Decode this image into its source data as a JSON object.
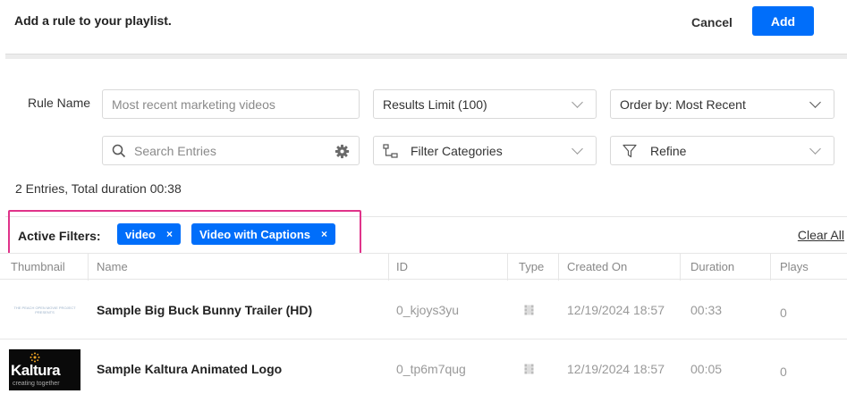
{
  "header": {
    "title": "Add a rule to your playlist.",
    "cancel_label": "Cancel",
    "add_label": "Add",
    "accent_color": "#006efa"
  },
  "form": {
    "rule_name_label": "Rule Name",
    "rule_name_placeholder": "Most recent marketing videos",
    "results_limit": "Results Limit (100)",
    "order_by": "Order by: Most Recent",
    "search_placeholder": "Search Entries",
    "filter_categories": "Filter Categories",
    "refine": "Refine"
  },
  "summary": "2 Entries, Total duration 00:38",
  "active_filters": {
    "label": "Active Filters:",
    "chips": [
      "video",
      "Video with Captions"
    ],
    "chip_close": "×",
    "clear_all": "Clear All",
    "highlight_color": "#e0338a"
  },
  "table": {
    "columns": [
      "Thumbnail",
      "Name",
      "ID",
      "Type",
      "Created On",
      "Duration",
      "Plays"
    ],
    "rows": [
      {
        "thumbnail_caption": "THE PEACH OPEN MOVIE PROJECT PRESENTS",
        "name": "Sample Big Buck Bunny Trailer (HD)",
        "id": "0_kjoys3yu",
        "type_icon": "film-icon",
        "created_on": "12/19/2024 18:57",
        "duration": "00:33",
        "plays": "0"
      },
      {
        "thumbnail_logo": "Kaltura",
        "thumbnail_tagline": "creating together",
        "name": "Sample Kaltura Animated Logo",
        "id": "0_tp6m7qug",
        "type_icon": "film-icon",
        "created_on": "12/19/2024 18:57",
        "duration": "00:05",
        "plays": "0"
      }
    ]
  }
}
